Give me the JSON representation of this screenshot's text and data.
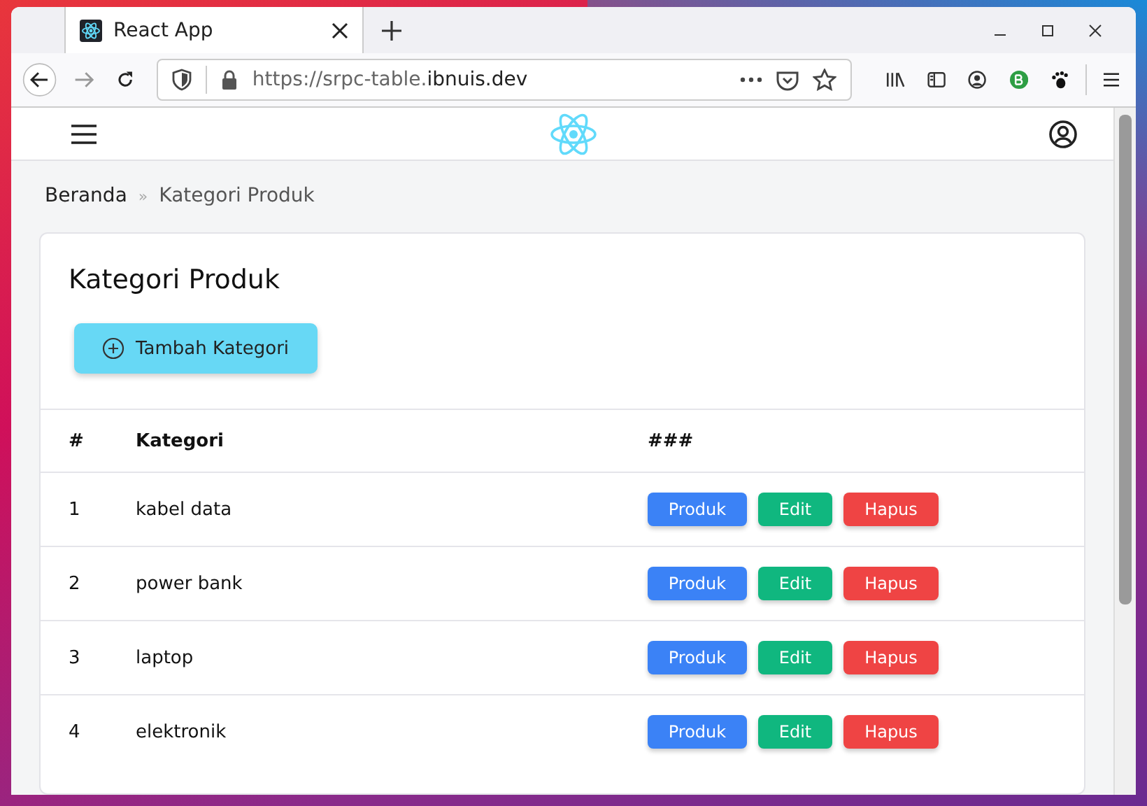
{
  "browser": {
    "tab": {
      "title": "React App",
      "selected": true
    },
    "address_bar": {
      "prefix": "https://srpc-table.",
      "domain": "ibnuis.dev"
    }
  },
  "breadcrumb": [
    {
      "label": "Beranda",
      "current": false
    },
    {
      "label": "Kategori Produk",
      "current": true
    }
  ],
  "breadcrumb_separator": "»",
  "card": {
    "title": "Kategori Produk",
    "add_button": "Tambah Kategori"
  },
  "table": {
    "columns": [
      "#",
      "Kategori",
      "###"
    ],
    "rows": [
      {
        "number": "1",
        "category": "kabel data",
        "actions": [
          {
            "label": "Produk",
            "kind": "primary"
          },
          {
            "label": "Edit",
            "kind": "success"
          },
          {
            "label": "Hapus",
            "kind": "danger"
          }
        ]
      },
      {
        "number": "2",
        "category": "power bank",
        "actions": [
          {
            "label": "Produk",
            "kind": "primary"
          },
          {
            "label": "Edit",
            "kind": "success"
          },
          {
            "label": "Hapus",
            "kind": "danger"
          }
        ]
      },
      {
        "number": "3",
        "category": "laptop",
        "actions": [
          {
            "label": "Produk",
            "kind": "primary"
          },
          {
            "label": "Edit",
            "kind": "success"
          },
          {
            "label": "Hapus",
            "kind": "danger"
          }
        ]
      },
      {
        "number": "4",
        "category": "elektronik",
        "actions": [
          {
            "label": "Produk",
            "kind": "primary"
          },
          {
            "label": "Edit",
            "kind": "success"
          },
          {
            "label": "Hapus",
            "kind": "danger"
          }
        ]
      }
    ]
  }
}
